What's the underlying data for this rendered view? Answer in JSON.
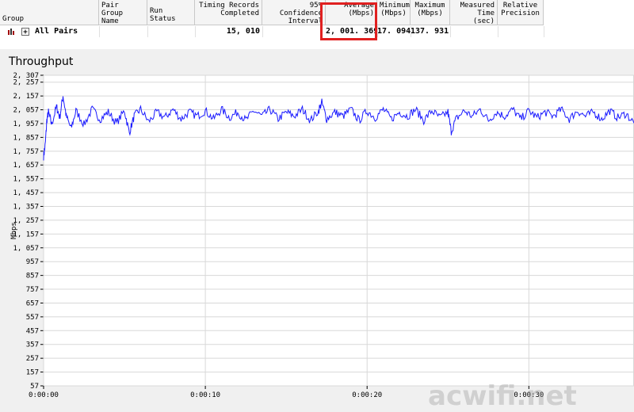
{
  "results_table": {
    "headers": [
      {
        "id": "group",
        "label": "Group"
      },
      {
        "id": "pair_group_name",
        "label": "Pair Group\nName"
      },
      {
        "id": "run_status",
        "label": "Run Status"
      },
      {
        "id": "timing_records",
        "label": "Timing Records\nCompleted"
      },
      {
        "id": "confidence",
        "label": "95% Confidence\nInterval"
      },
      {
        "id": "average",
        "label": "Average\n(Mbps)"
      },
      {
        "id": "minimum",
        "label": "Minimum\n(Mbps)"
      },
      {
        "id": "maximum",
        "label": "Maximum\n(Mbps)"
      },
      {
        "id": "measured_time",
        "label": "Measured\nTime (sec)"
      },
      {
        "id": "relative_precision",
        "label": "Relative\nPrecision"
      }
    ],
    "row": {
      "group": "All Pairs",
      "timing_records": "15, 010",
      "average": "2, 001. 369",
      "minimum": "17. 094",
      "maximum": "137. 931"
    }
  },
  "chart": {
    "title": "Throughput",
    "ylabel": "Mbps",
    "watermark": "acwifi.net",
    "line_color": "#1a1aff"
  },
  "chart_data": {
    "type": "line",
    "title": "Throughput",
    "xlabel": "",
    "ylabel": "Mbps",
    "ylim": [
      57,
      2307
    ],
    "y_ticks": [
      "2, 307",
      "2, 257",
      "2, 157",
      "2, 057",
      "1, 957",
      "1, 857",
      "1, 757",
      "1, 657",
      "1, 557",
      "1, 457",
      "1, 357",
      "1, 257",
      "1, 157",
      "1, 057",
      "957",
      "857",
      "757",
      "657",
      "557",
      "457",
      "357",
      "257",
      "157",
      "57"
    ],
    "y_tick_values": [
      2307,
      2257,
      2157,
      2057,
      1957,
      1857,
      1757,
      1657,
      1557,
      1457,
      1357,
      1257,
      1157,
      1057,
      957,
      857,
      757,
      657,
      557,
      457,
      357,
      257,
      157,
      57
    ],
    "x_ticks": [
      "0:00:00",
      "0:00:10",
      "0:00:20",
      "0:00:30"
    ],
    "x_tick_seconds": [
      0,
      10,
      20,
      30
    ],
    "xlim_seconds": [
      0,
      36.5
    ],
    "grid": true,
    "series": [
      {
        "x": [
          0,
          0.1,
          0.2,
          0.3,
          0.5,
          0.8,
          1.0,
          1.2,
          1.4,
          1.7,
          2.0,
          2.5,
          3.0,
          3.5,
          4.0,
          4.5,
          5.0,
          5.3,
          5.6,
          6.0,
          6.5,
          7.0,
          7.5,
          8.0,
          8.5,
          9.0,
          9.5,
          10.0,
          10.5,
          11.0,
          11.5,
          12.0,
          12.5,
          13.0,
          13.5,
          14.0,
          14.5,
          15.0,
          15.5,
          16.0,
          16.5,
          17.0,
          17.2,
          17.5,
          18.0,
          18.5,
          19.0,
          19.5,
          20.0,
          20.5,
          21.0,
          21.5,
          22.0,
          22.5,
          23.0,
          23.5,
          24.0,
          24.5,
          25.0,
          25.2,
          25.5,
          26.0,
          26.5,
          27.0,
          27.5,
          28.0,
          28.5,
          29.0,
          29.5,
          30.0,
          30.5,
          31.0,
          31.5,
          32.0,
          32.5,
          33.0,
          33.5,
          34.0,
          34.5,
          35.0,
          35.5,
          36.0,
          36.5
        ],
        "values": [
          1720,
          1800,
          1980,
          2040,
          1950,
          2080,
          2000,
          2160,
          2010,
          1920,
          2050,
          1950,
          2060,
          1990,
          2040,
          1960,
          2050,
          1890,
          2010,
          2060,
          1970,
          2040,
          2000,
          2060,
          1990,
          2040,
          2010,
          2050,
          1990,
          2060,
          2000,
          2040,
          1980,
          2050,
          2010,
          2060,
          1990,
          2040,
          2010,
          2060,
          1980,
          2050,
          2110,
          1990,
          2040,
          2010,
          2060,
          1980,
          2050,
          2000,
          2060,
          1990,
          2040,
          2010,
          2060,
          1980,
          2050,
          2000,
          2040,
          1900,
          1990,
          2050,
          2010,
          2060,
          1980,
          2040,
          2010,
          2060,
          1990,
          2050,
          2000,
          2040,
          2010,
          2060,
          1990,
          2050,
          2010,
          2040,
          1990,
          2050,
          2000,
          2030,
          1960
        ]
      }
    ]
  }
}
